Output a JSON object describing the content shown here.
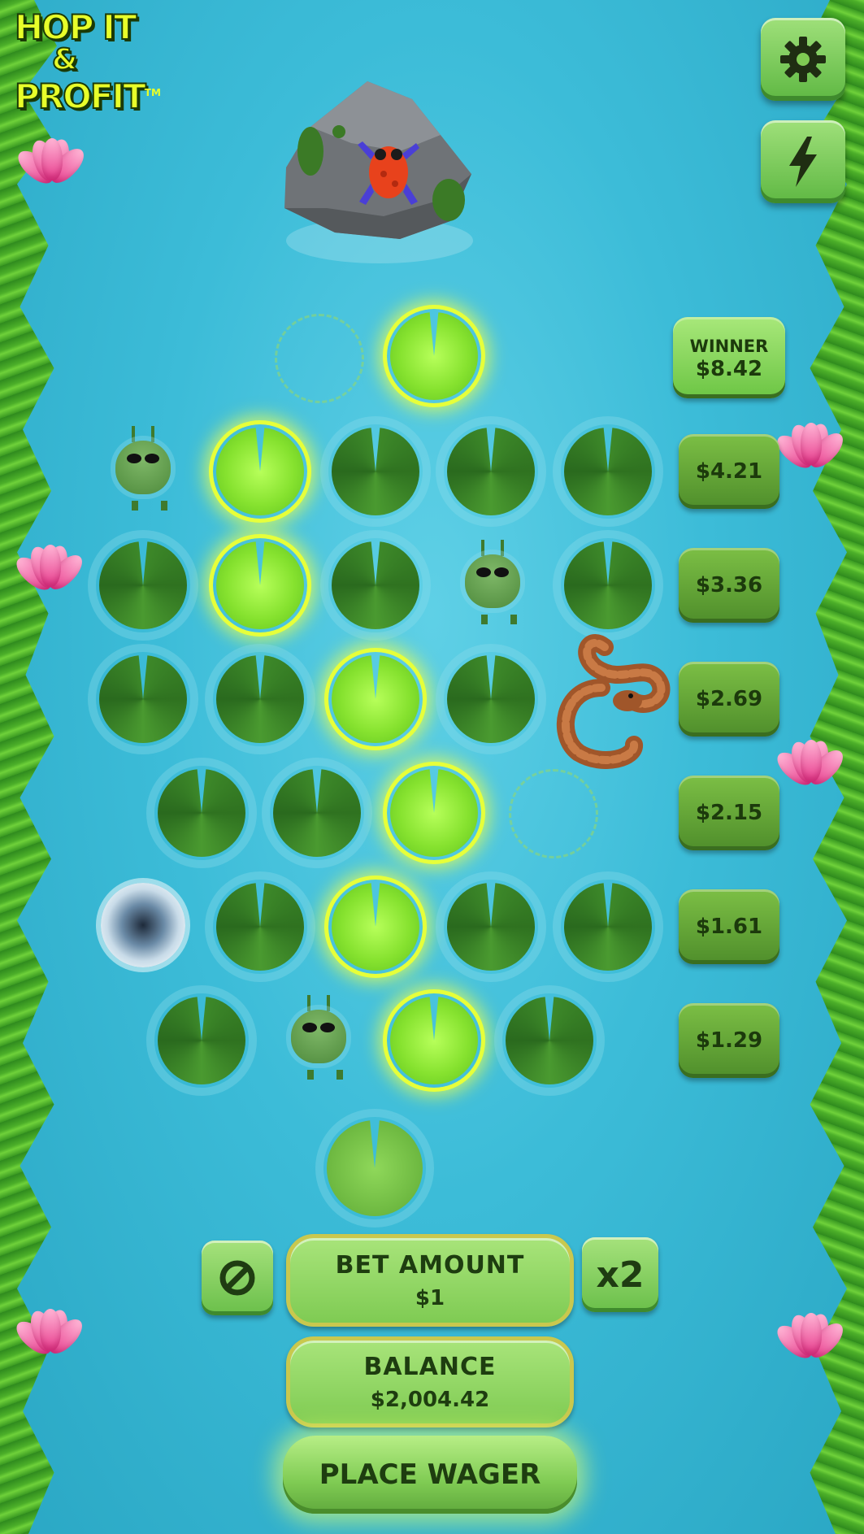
{
  "game": {
    "logo": {
      "line1": "HOP IT",
      "line2": "&",
      "line3": "PROFIT",
      "tm": "TM"
    },
    "icons": {
      "settings": "gear-icon",
      "turbo": "lightning-icon",
      "clear_bet": "no-entry-icon"
    }
  },
  "payout_ladder": [
    {
      "label": "WINNER",
      "value": "$8.42",
      "is_winner": true
    },
    {
      "value": "$4.21"
    },
    {
      "value": "$3.36"
    },
    {
      "value": "$2.69"
    },
    {
      "value": "$2.15"
    },
    {
      "value": "$1.61"
    },
    {
      "value": "$1.29"
    }
  ],
  "controls": {
    "double_label": "x2",
    "bet": {
      "label": "BET AMOUNT",
      "value": "$1"
    },
    "balance": {
      "label": "BALANCE",
      "value": "$2,004.42"
    },
    "place_wager_label": "PLACE WAGER"
  },
  "colors": {
    "water": "#3cbcd8",
    "lit_pad": "#9bf040",
    "pad": "#3e8a2a",
    "button": "#7fcb53"
  }
}
